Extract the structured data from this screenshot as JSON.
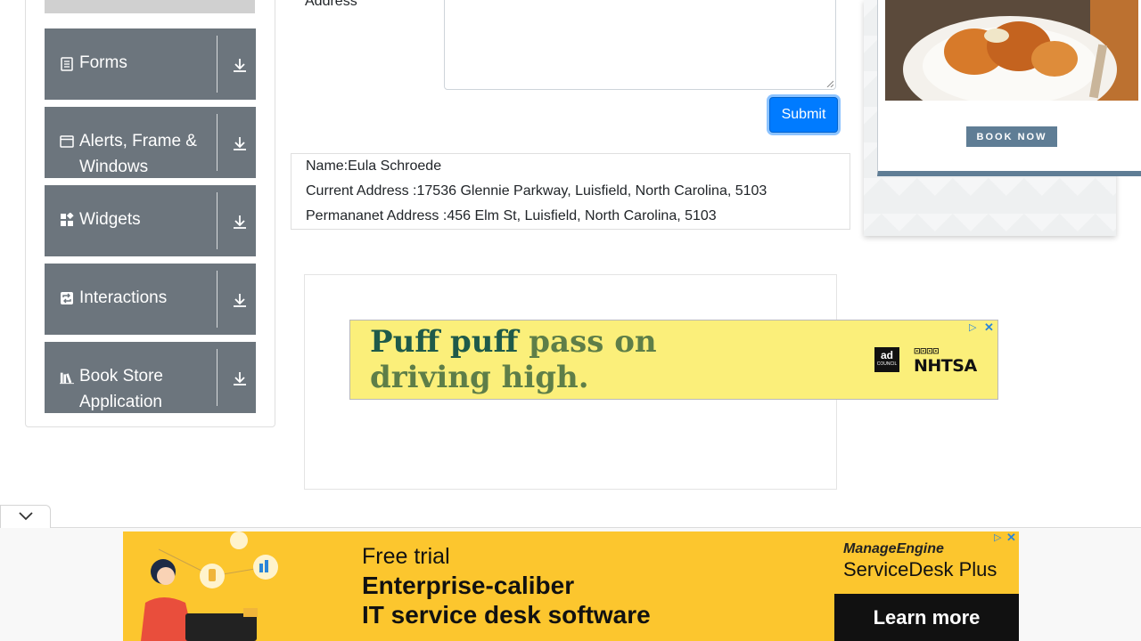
{
  "sidebar": {
    "groups": [
      {
        "label": "Forms",
        "icon": "form-icon"
      },
      {
        "label": "Alerts, Frame & Windows",
        "icon": "window-icon"
      },
      {
        "label": "Widgets",
        "icon": "widgets-icon"
      },
      {
        "label": "Interactions",
        "icon": "interactions-icon"
      },
      {
        "label": "Book Store Application",
        "icon": "book-icon"
      }
    ]
  },
  "form": {
    "permanent_address_label": "Address",
    "submit_label": "Submit"
  },
  "output": {
    "name": "Name:Eula Schroede",
    "current_address": "Current Address :17536 Glennie Parkway, Luisfield, North Carolina, 5103",
    "permanent_address": "Permananet Address :456 Elm St, Luisfield, North Carolina, 5103"
  },
  "ads": {
    "banner": {
      "line1_dark": "Puff puff",
      "line1_light": "pass on",
      "line2_light": "driving high.",
      "logo1": "ad",
      "logo1_sub": "COUNCIL",
      "logo2": "NHTSA",
      "logo2_mark": "⊡⊡⊡⊡"
    },
    "side": {
      "cta": "BOOK NOW"
    },
    "bottom": {
      "line1": "Free trial",
      "line2": "Enterprise-caliber",
      "line3": "IT service desk software",
      "brand": "ManageEngine",
      "product": "ServiceDesk Plus",
      "cta": "Learn more"
    }
  },
  "colors": {
    "sidebar_group_bg": "#6c757d",
    "submit_bg": "#007bff",
    "banner_bg": "#fbef7a",
    "bottom_ad_bg": "#fcc62e"
  }
}
